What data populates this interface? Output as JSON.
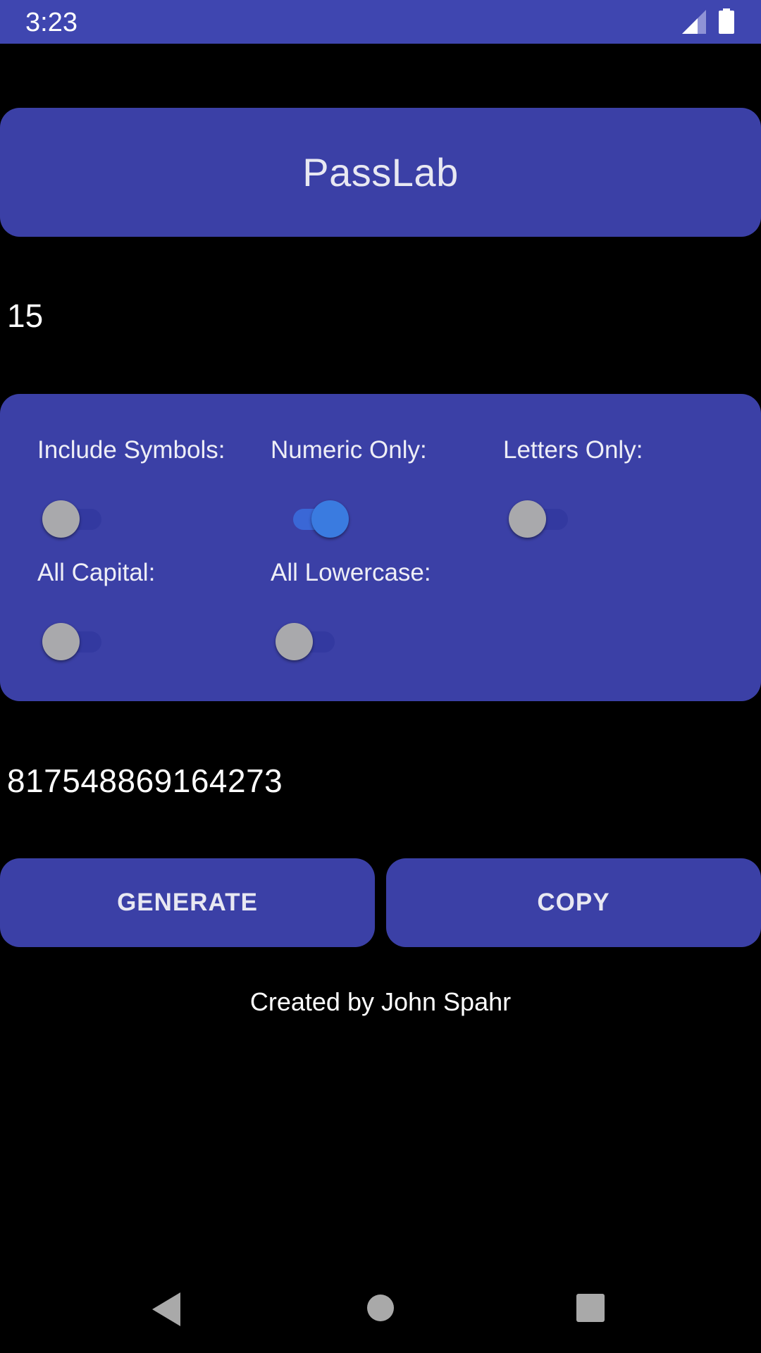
{
  "status_bar": {
    "time": "3:23",
    "icons": [
      "signal-icon",
      "battery-icon"
    ],
    "color": "#3f46b0"
  },
  "app": {
    "title": "PassLab",
    "accent_color": "#3b40a6",
    "toggle_on_color": "#3a7be0"
  },
  "length": {
    "value": "15"
  },
  "options": [
    {
      "label": "Include Symbols:",
      "on": false
    },
    {
      "label": "Numeric Only:",
      "on": true
    },
    {
      "label": "Letters Only:",
      "on": false
    },
    {
      "label": "All Capital:",
      "on": false
    },
    {
      "label": "All Lowercase:",
      "on": false
    }
  ],
  "password": {
    "value": "817548869164273"
  },
  "buttons": {
    "generate": "GENERATE",
    "copy": "COPY"
  },
  "footer": {
    "credit": "Created by John Spahr"
  },
  "nav": {
    "icons": [
      "back-icon",
      "home-icon",
      "recents-icon"
    ]
  }
}
